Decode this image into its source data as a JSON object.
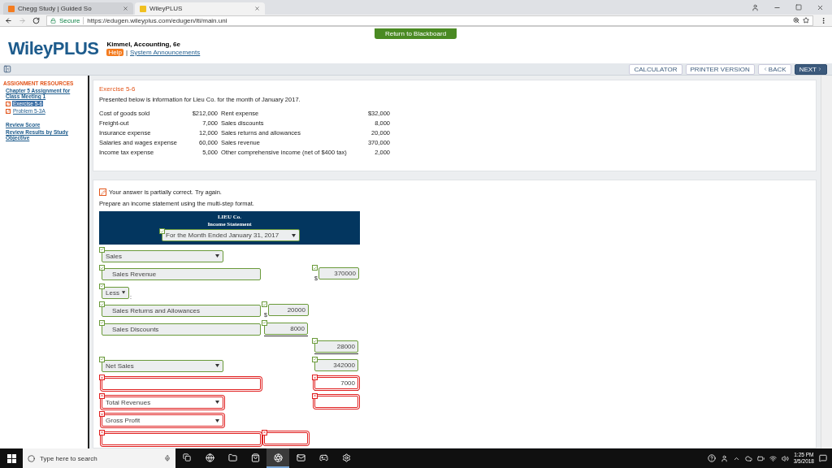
{
  "browser": {
    "tabs": [
      {
        "title": "Chegg Study | Guided So",
        "selected": false
      },
      {
        "title": "WileyPLUS",
        "selected": true
      }
    ],
    "secure_label": "Secure",
    "url": "https://edugen.wileyplus.com/edugen/lti/main.uni"
  },
  "header": {
    "return_button": "Return to Blackboard",
    "logo": "WileyPLUS",
    "course": "Kimmel, Accounting, 6e",
    "help": "Help",
    "separator": "|",
    "announcements": "System Announcements"
  },
  "toolbar": {
    "buttons": [
      {
        "label": "CALCULATOR",
        "kind": "plain"
      },
      {
        "label": "PRINTER VERSION",
        "kind": "plain"
      },
      {
        "label": "BACK",
        "kind": "back"
      },
      {
        "label": "NEXT",
        "kind": "next"
      }
    ]
  },
  "sidebar": {
    "heading": "ASSIGNMENT RESOURCES",
    "assignment": "Chapter 5 Assignment for Class Meeting 1",
    "items": [
      {
        "label": "Exercise 5-6",
        "selected": true
      },
      {
        "label": "Problem 5-3A",
        "selected": false
      }
    ],
    "links": [
      "Review Score",
      "Review Results by Study Objective"
    ]
  },
  "exercise": {
    "title": "Exercise 5-6",
    "intro": "Presented below is information for Lieu Co. for the month of January 2017.",
    "rows": [
      {
        "label_1": "Cost of goods sold",
        "value_1": "$212,000",
        "label_2": "Rent expense",
        "value_2": "$32,000"
      },
      {
        "label_1": "Freight-out",
        "value_1": "7,000",
        "label_2": "Sales discounts",
        "value_2": "8,000"
      },
      {
        "label_1": "Insurance expense",
        "value_1": "12,000",
        "label_2": "Sales returns and allowances",
        "value_2": "20,000"
      },
      {
        "label_1": "Salaries and wages expense",
        "value_1": "60,000",
        "label_2": "Sales revenue",
        "value_2": "370,000"
      },
      {
        "label_1": "Income tax expense",
        "value_1": "5,000",
        "label_2": "Other comprehensive income (net of $400 tax)",
        "value_2": "2,000"
      }
    ]
  },
  "answer": {
    "feedback": "Your answer is partially correct.  Try again.",
    "instruction": "Prepare an income statement using the multi-step format.",
    "statement": {
      "company": "LIEU Co.",
      "title": "Income Statement",
      "period": {
        "value": "For the Month Ended January 31, 2017",
        "correct": true
      }
    },
    "rows": [
      {
        "left": {
          "kind": "select",
          "value": "Sales",
          "correct": true
        }
      },
      {
        "left": {
          "kind": "input",
          "value": "Sales Revenue",
          "correct": true
        },
        "right": {
          "value": "370000",
          "currency": "$",
          "correct": true,
          "underlined": false
        }
      },
      {
        "left": {
          "kind": "short-select",
          "value": "Less",
          "suffix": ":",
          "correct": true
        }
      },
      {
        "left": {
          "kind": "input",
          "value": "Sales Returns and Allowances",
          "correct": true
        },
        "middle": {
          "value": "20000",
          "currency": "$",
          "correct": true,
          "underlined": false
        }
      },
      {
        "left": {
          "kind": "input",
          "value": "Sales Discounts",
          "correct": true
        },
        "middle": {
          "value": "8000",
          "correct": true,
          "underlined": true
        }
      },
      {
        "right": {
          "value": "28000",
          "correct": true,
          "underlined": true
        }
      },
      {
        "left": {
          "kind": "select",
          "value": "Net Sales",
          "correct": true
        },
        "right": {
          "value": "342000",
          "correct": true,
          "underlined": false
        }
      },
      {
        "left": {
          "kind": "input",
          "correct": false
        },
        "right": {
          "value": "7000",
          "correct": false,
          "underlined": true
        }
      },
      {
        "left": {
          "kind": "select",
          "value": "Total Revenues",
          "correct": false
        },
        "right": {
          "correct": false,
          "underlined": false
        }
      },
      {
        "left": {
          "kind": "select",
          "value": "Gross Profit",
          "correct": false
        }
      },
      {
        "left": {
          "kind": "input",
          "correct": false
        },
        "middle": {
          "correct": false,
          "underlined": false
        }
      }
    ]
  },
  "taskbar": {
    "search_placeholder": "Type here to search",
    "apps": [
      {
        "kind": "edge",
        "selected": false
      },
      {
        "kind": "folder",
        "selected": false
      },
      {
        "kind": "store",
        "selected": false
      },
      {
        "kind": "chrome",
        "selected": true
      },
      {
        "kind": "mail",
        "selected": false
      },
      {
        "kind": "steam",
        "selected": false
      },
      {
        "kind": "settings",
        "selected": false
      }
    ],
    "time": "1:25 PM",
    "date": "3/5/2018"
  }
}
